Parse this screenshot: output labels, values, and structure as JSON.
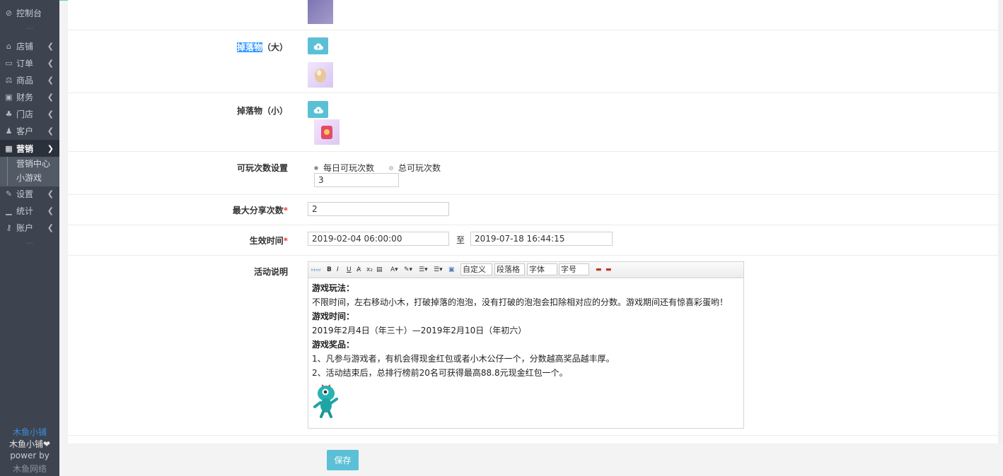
{
  "sidebar": {
    "items": [
      {
        "label": "控制台",
        "icon": "dashboard-icon"
      },
      {
        "label": "店铺",
        "icon": "store-icon"
      },
      {
        "label": "订单",
        "icon": "truck-icon"
      },
      {
        "label": "商品",
        "icon": "scale-icon"
      },
      {
        "label": "财务",
        "icon": "money-icon"
      },
      {
        "label": "门店",
        "icon": "sitemap-icon"
      },
      {
        "label": "客户",
        "icon": "users-icon"
      },
      {
        "label": "营销",
        "icon": "gift-icon"
      },
      {
        "label": "设置",
        "icon": "wrench-icon"
      },
      {
        "label": "统计",
        "icon": "signal-icon"
      },
      {
        "label": "账户",
        "icon": "key-icon"
      }
    ],
    "sub_items": [
      {
        "label": "营销中心"
      },
      {
        "label": "小游戏"
      }
    ],
    "brand": {
      "link": "木鱼小铺",
      "name": "木鱼小铺❤",
      "power": "power by",
      "company": "木鱼网络"
    }
  },
  "form": {
    "drop_large_label_hl": "掉落物",
    "drop_large_label_rest": "（大）",
    "drop_small_label": "掉落物（小）",
    "play_count_label": "可玩次数设置",
    "radio_daily": "每日可玩次数",
    "radio_total": "总可玩次数",
    "play_count_value": "3",
    "max_share_label": "最大分享次数",
    "max_share_value": "2",
    "required_mark": "*",
    "effective_time_label": "生效时间",
    "start_time": "2019-02-04 06:00:00",
    "to_label": "至",
    "end_time": "2019-07-18 16:44:15",
    "description_label": "活动说明",
    "save_label": "保存"
  },
  "editor": {
    "toolbar": {
      "custom": "自定义",
      "paragraph": "段落格",
      "font": "字体",
      "size": "字号"
    },
    "content": {
      "h1": "游戏玩法：",
      "p1": "不限时间，左右移动小木，打破掉落的泡泡，没有打破的泡泡会扣除相对应的分数。游戏期间还有惊喜彩蛋哟！",
      "h2": "游戏时间：",
      "p2": "2019年2月4日（年三十）—2019年2月10日（年初六）",
      "h3": "游戏奖品：",
      "p3": "1、凡参与游戏者，有机会得现金红包或者小木公仔一个，分数越高奖品越丰厚。",
      "p4": "2、活动结束后，总排行榜前20名可获得最高88.8元现金红包一个。"
    }
  },
  "colors": {
    "sidebar_bg": "#3d4450",
    "accent": "#5bc0d5",
    "required": "#e5493a",
    "link": "#3c8dde"
  }
}
